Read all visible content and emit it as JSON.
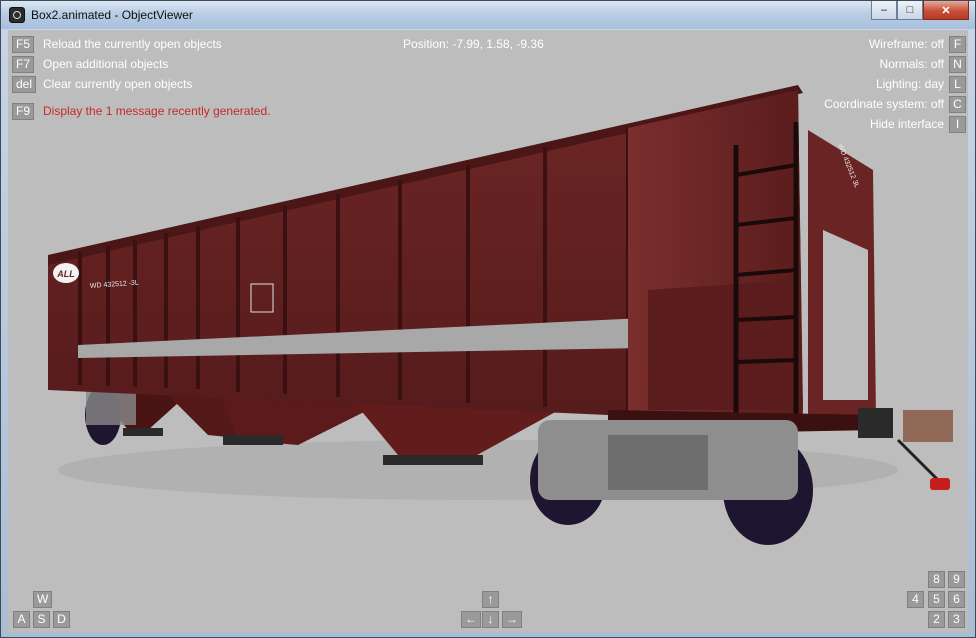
{
  "window": {
    "title": "Box2.animated - ObjectViewer",
    "buttons": {
      "minimize": "–",
      "maximize": "□",
      "close": "✕"
    }
  },
  "hud": {
    "position": "Position: -7.99, 1.58, -9.36",
    "left_commands": [
      {
        "key": "F5",
        "label": "Reload the currently open objects"
      },
      {
        "key": "F7",
        "label": "Open additional objects"
      },
      {
        "key": "del",
        "label": "Clear currently open objects"
      }
    ],
    "message": {
      "key": "F9",
      "label": "Display the 1 message recently generated."
    },
    "right_toggles": [
      {
        "label": "Wireframe: off",
        "key": "F"
      },
      {
        "label": "Normals: off",
        "key": "N"
      },
      {
        "label": "Lighting: day",
        "key": "L"
      },
      {
        "label": "Coordinate system: off",
        "key": "C"
      },
      {
        "label": "Hide interface",
        "key": "I"
      }
    ],
    "move_keys": {
      "w": "W",
      "a": "A",
      "s": "S",
      "d": "D"
    },
    "arrow_keys": {
      "up": "↑",
      "left": "←",
      "down": "↓",
      "right": "→"
    },
    "numpad_keys": {
      "k8": "8",
      "k9": "9",
      "k4": "4",
      "k5": "5",
      "k6": "6",
      "k2": "2",
      "k3": "3"
    }
  },
  "model": {
    "logo": "ALL",
    "reporting_mark": "WD  432512  -3L",
    "end_mark": "WD  432512  3L",
    "body_color": "#6b2424",
    "stripe_color": "#a8a8a8",
    "background_color": "#bdbdbd"
  }
}
